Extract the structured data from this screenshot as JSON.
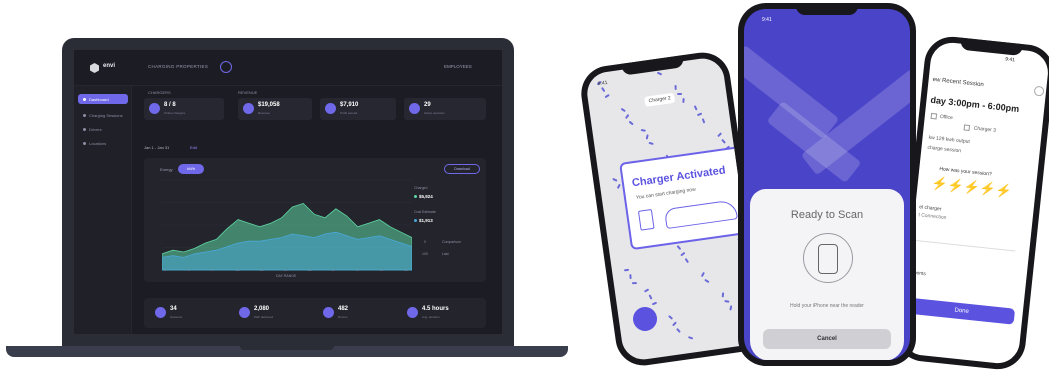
{
  "laptop": {
    "app_name": "envi",
    "org_name": "CHARGING PROPERTIES",
    "user_menu": "EMPLOYEES",
    "sidebar": [
      {
        "label": "Dashboard",
        "active": true
      },
      {
        "label": "Charging Sessions",
        "active": false
      },
      {
        "label": "Drivers",
        "active": false
      },
      {
        "label": "Locations",
        "active": false
      }
    ],
    "section_labels": {
      "chargers": "CHARGERS",
      "revenue": "REVENUE"
    },
    "stats_top": [
      {
        "value": "8 / 8",
        "sub": "Online chargers"
      },
      {
        "value": "$19,058",
        "sub": "Revenue"
      },
      {
        "value": "$7,910",
        "sub": "Profit earned"
      },
      {
        "value": "29",
        "sub": "Active sessions"
      }
    ],
    "date_range": "Jan 1 - Jan 31",
    "date_edit": "Edit",
    "chart_panel": {
      "left_label": "Energy",
      "pill": "kWh",
      "right_button": "Download",
      "legend": [
        {
          "label": "Charged",
          "value": "$5,924",
          "color": "#5fd6a3"
        },
        {
          "label": "Cost Estimate",
          "value": "$1,913",
          "color": "#4aa8d8"
        }
      ],
      "toggles": [
        {
          "label": "Comparison",
          "value": "0"
        },
        {
          "label": "Last",
          "value": "100"
        }
      ],
      "x_labels": [
        "3",
        "6",
        "9",
        "12",
        "15",
        "18",
        "21",
        "24",
        "27",
        "30",
        "31"
      ],
      "x_title": "DAY RANGE"
    },
    "chart_data": {
      "type": "area",
      "series": [
        {
          "name": "Charged",
          "color": "#5fd6a3",
          "values": [
            18,
            22,
            20,
            24,
            30,
            34,
            46,
            56,
            52,
            48,
            52,
            58,
            70,
            74,
            62,
            58,
            68,
            60,
            48,
            52,
            56,
            48,
            42,
            36
          ]
        },
        {
          "name": "Cost Estimate",
          "color": "#4aa8d8",
          "values": [
            14,
            16,
            14,
            18,
            20,
            22,
            26,
            30,
            32,
            32,
            34,
            36,
            40,
            38,
            36,
            40,
            42,
            38,
            34,
            36,
            38,
            34,
            30,
            26
          ]
        }
      ],
      "ylim": [
        0,
        100
      ]
    },
    "stats_bottom": [
      {
        "value": "34",
        "sub": "Sessions"
      },
      {
        "value": "2,080",
        "sub": "kWh delivered"
      },
      {
        "value": "482",
        "sub": "Drivers"
      },
      {
        "value": "4.5 hours",
        "sub": "Avg. duration"
      }
    ]
  },
  "phone_left": {
    "status_time": "9:41",
    "map_label": "Charger 2",
    "banner_title": "Charger Activated",
    "banner_sub": "You can start charging now"
  },
  "phone_mid": {
    "status_time": "9:41",
    "title": "Ready to Scan",
    "hint": "Hold your iPhone near the reader",
    "cancel": "Cancel"
  },
  "phone_right": {
    "status_time": "9:41",
    "header": "ew Recent Session",
    "time_range": "day 3:00pm - 6:00pm",
    "opt_office": "Office",
    "opt_charger": "Charger 3",
    "amount_line": "kw 129 kwh output",
    "session_label": "charge session",
    "rate_prompt": "How was your session?",
    "field_a": "el charger",
    "field_a_sub": "t Connection",
    "field_b": "ments",
    "done": "Done"
  }
}
